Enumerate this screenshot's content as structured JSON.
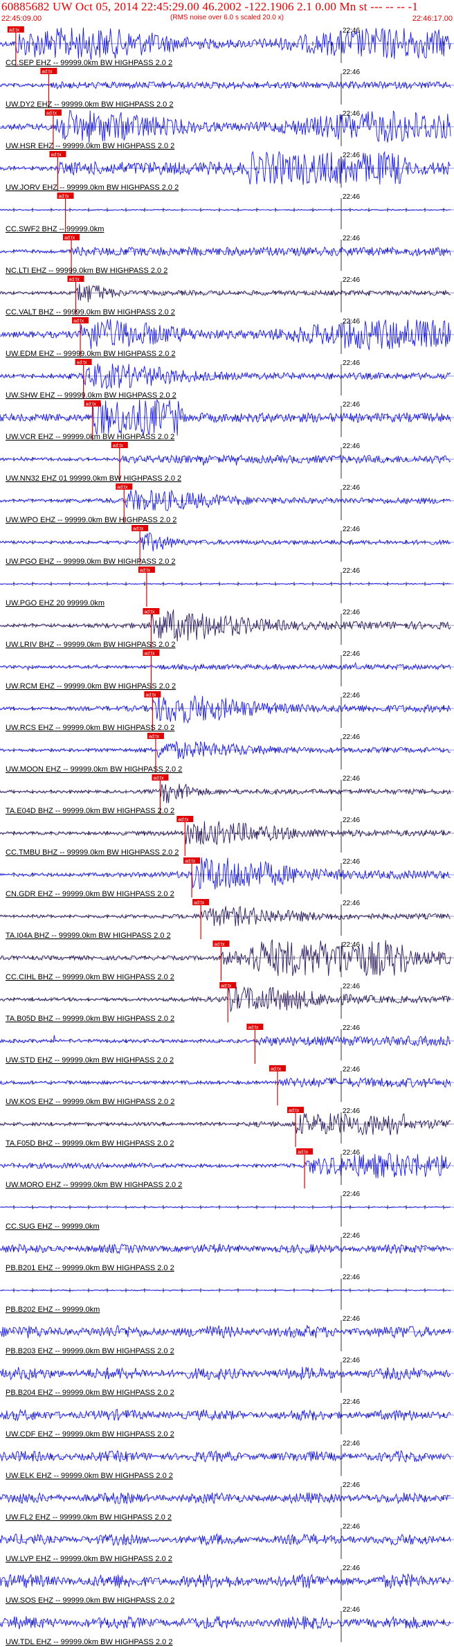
{
  "header": {
    "title": "60885682 UW Oct 05, 2014 22:45:29.00   46.2002 -122.1906  2.1 0.00 Mn st --- -- --  -1",
    "subtitle": "(RMS noise over 6.0 s scaled 20.0 x)",
    "start_time": "22:45:09.00",
    "end_time": "22:46:17.00"
  },
  "tick_label": "22:46",
  "pick_label": "ad:tx",
  "colors": {
    "header_text": "#e00000",
    "trace_blue": "#1a1ae6",
    "trace_dark": "#2a1a5e",
    "pick": "#e00000",
    "label": "#000000"
  },
  "stations": [
    {
      "name": "CC.SEP EHZ -- 99999.0km BW  HIGHPASS  2.0  2",
      "color": "blue",
      "pick": 0.035,
      "amp": 0.85,
      "env": "wide"
    },
    {
      "name": "UW.DY2 EHZ -- 99999.0km BW  HIGHPASS  2.0  2",
      "color": "blue",
      "pick": 0.108,
      "amp": 0.25,
      "env": "low"
    },
    {
      "name": "UW.HSR EHZ -- 99999.0km BW  HIGHPASS  2.0  2",
      "color": "blue",
      "pick": 0.118,
      "amp": 0.85,
      "env": "wide"
    },
    {
      "name": "UW.JORV EHZ -- 99999.0km BW  HIGHPASS  2.0  2",
      "color": "blue",
      "pick": 0.128,
      "amp": 0.85,
      "env": "late"
    },
    {
      "name": "CC.SWF2 BHZ -- 99999.0km",
      "color": "blue",
      "pick": 0.145,
      "amp": 0.0,
      "env": "none"
    },
    {
      "name": "NC.LTI EHZ -- 99999.0km BW  HIGHPASS  2.0  2",
      "color": "blue",
      "pick": 0.158,
      "amp": 0.35,
      "env": "low"
    },
    {
      "name": "CC.VALT BHZ -- 99999.0km BW  HIGHPASS  2.0  2",
      "color": "dark",
      "pick": 0.168,
      "amp": 0.45,
      "env": "spike"
    },
    {
      "name": "UW.EDM EHZ -- 99999.0km BW  HIGHPASS  2.0  2",
      "color": "blue",
      "pick": 0.178,
      "amp": 0.85,
      "env": "wide"
    },
    {
      "name": "UW.SHW EHZ -- 99999.0km BW  HIGHPASS  2.0  2",
      "color": "blue",
      "pick": 0.185,
      "amp": 0.6,
      "env": "mid"
    },
    {
      "name": "UW.VCR EHZ -- 99999.0km BW  HIGHPASS  2.0  2",
      "color": "blue",
      "pick": 0.205,
      "amp": 0.95,
      "env": "early"
    },
    {
      "name": "UW.NN32 EHZ 01 99999.0km BW  HIGHPASS  2.0  2",
      "color": "blue",
      "pick": 0.265,
      "amp": 0.3,
      "env": "low"
    },
    {
      "name": "UW.WPO EHZ -- 99999.0km BW  HIGHPASS  2.0  2",
      "color": "blue",
      "pick": 0.275,
      "amp": 0.5,
      "env": "mid"
    },
    {
      "name": "UW.PGO EHZ -- 99999.0km BW  HIGHPASS  2.0  2",
      "color": "blue",
      "pick": 0.31,
      "amp": 0.4,
      "env": "spike"
    },
    {
      "name": "UW.PGO EHZ 20 99999.0km",
      "color": "blue",
      "pick": 0.325,
      "amp": 0.0,
      "env": "none"
    },
    {
      "name": "UW.LRIV BHZ -- 99999.0km BW  HIGHPASS  2.0  2",
      "color": "dark",
      "pick": 0.335,
      "amp": 0.75,
      "env": "mid"
    },
    {
      "name": "UW.RCM EHZ -- 99999.0km BW  HIGHPASS  2.0  2",
      "color": "blue",
      "pick": 0.335,
      "amp": 0.15,
      "env": "low"
    },
    {
      "name": "UW.RCS EHZ -- 99999.0km BW  HIGHPASS  2.0  2",
      "color": "blue",
      "pick": 0.338,
      "amp": 0.7,
      "env": "mid"
    },
    {
      "name": "UW.MOON EHZ -- 99999.0km BW  HIGHPASS  2.0  2",
      "color": "blue",
      "pick": 0.345,
      "amp": 0.4,
      "env": "mid"
    },
    {
      "name": "TA.E04D BHZ -- 99999.0km BW  HIGHPASS  2.0  2",
      "color": "dark",
      "pick": 0.355,
      "amp": 0.5,
      "env": "spike"
    },
    {
      "name": "CC.TMBU BHZ -- 99999.0km BW  HIGHPASS  2.0  2",
      "color": "dark",
      "pick": 0.41,
      "amp": 0.55,
      "env": "mid"
    },
    {
      "name": "CN.GDR EHZ -- 99999.0km BW  HIGHPASS  2.0  2",
      "color": "blue",
      "pick": 0.425,
      "amp": 0.85,
      "env": "mid"
    },
    {
      "name": "TA.I04A BHZ -- 99999.0km BW  HIGHPASS  2.0  2",
      "color": "dark",
      "pick": 0.445,
      "amp": 0.45,
      "env": "mid"
    },
    {
      "name": "CC.CIHL BHZ -- 99999.0km BW  HIGHPASS  2.0  2",
      "color": "dark",
      "pick": 0.49,
      "amp": 0.95,
      "env": "late"
    },
    {
      "name": "TA.B05D BHZ -- 99999.0km BW  HIGHPASS  2.0  2",
      "color": "dark",
      "pick": 0.505,
      "amp": 0.6,
      "env": "mid"
    },
    {
      "name": "UW.STD EHZ -- 99999.0km BW  HIGHPASS  2.0  2",
      "color": "blue",
      "pick": 0.565,
      "amp": 0.4,
      "env": "low"
    },
    {
      "name": "UW.KOS EHZ -- 99999.0km BW  HIGHPASS  2.0  2",
      "color": "blue",
      "pick": 0.615,
      "amp": 0.4,
      "env": "low"
    },
    {
      "name": "TA.F05D BHZ -- 99999.0km BW  HIGHPASS  2.0  2",
      "color": "dark",
      "pick": 0.655,
      "amp": 0.55,
      "env": "late"
    },
    {
      "name": "UW.MORO EHZ -- 99999.0km BW  HIGHPASS  2.0  2",
      "color": "blue",
      "pick": 0.675,
      "amp": 0.65,
      "env": "wide"
    },
    {
      "name": "CC.SUG EHZ -- 99999.0km",
      "color": "blue",
      "pick": -1,
      "amp": 0.0,
      "env": "none"
    },
    {
      "name": "PB.B201 EHZ -- 99999.0km BW  HIGHPASS  2.0  2",
      "color": "blue",
      "pick": -1,
      "amp": 0.2,
      "env": "noise"
    },
    {
      "name": "PB.B202 EHZ -- 99999.0km",
      "color": "blue",
      "pick": -1,
      "amp": 0.0,
      "env": "none"
    },
    {
      "name": "PB.B203 EHZ -- 99999.0km BW  HIGHPASS  2.0  2",
      "color": "blue",
      "pick": -1,
      "amp": 0.3,
      "env": "noise"
    },
    {
      "name": "PB.B204 EHZ -- 99999.0km BW  HIGHPASS  2.0  2",
      "color": "blue",
      "pick": -1,
      "amp": 0.3,
      "env": "noise"
    },
    {
      "name": "UW.CDF EHZ -- 99999.0km BW  HIGHPASS  2.0  2",
      "color": "blue",
      "pick": -1,
      "amp": 0.25,
      "env": "noise"
    },
    {
      "name": "UW.ELK EHZ -- 99999.0km BW  HIGHPASS  2.0  2",
      "color": "blue",
      "pick": -1,
      "amp": 0.25,
      "env": "noise"
    },
    {
      "name": "UW.FL2 EHZ -- 99999.0km BW  HIGHPASS  2.0  2",
      "color": "blue",
      "pick": -1,
      "amp": 0.25,
      "env": "noise"
    },
    {
      "name": "UW.LVP EHZ -- 99999.0km BW  HIGHPASS  2.0  2",
      "color": "blue",
      "pick": -1,
      "amp": 0.25,
      "env": "noise"
    },
    {
      "name": "UW.SOS EHZ -- 99999.0km BW  HIGHPASS  2.0  2",
      "color": "blue",
      "pick": -1,
      "amp": 0.35,
      "env": "noise"
    },
    {
      "name": "UW.TDL EHZ -- 99999.0km BW  HIGHPASS  2.0  2",
      "color": "blue",
      "pick": -1,
      "amp": 0.3,
      "env": "noise"
    }
  ]
}
